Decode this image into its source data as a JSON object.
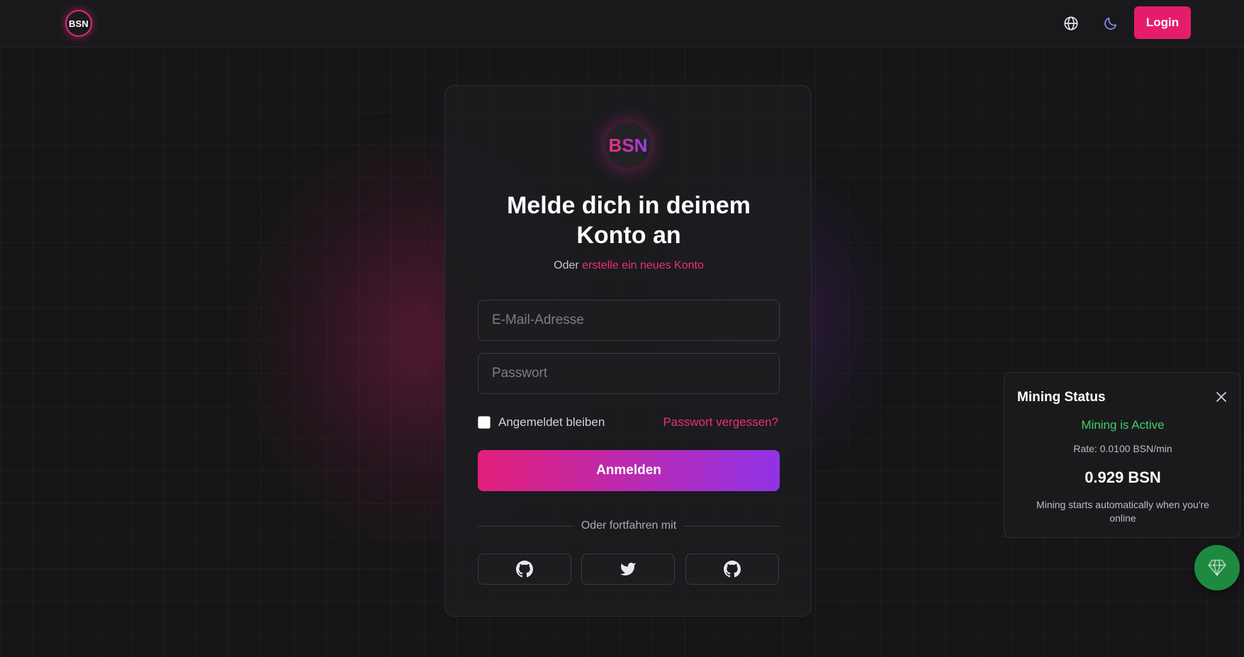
{
  "header": {
    "logo_text": "BSN",
    "login_label": "Login",
    "icons": [
      "globe-icon",
      "moon-icon"
    ]
  },
  "card": {
    "logo_text": "BSN",
    "title_line1": "Melde dich in deinem",
    "title_line2": "Konto an",
    "subtitle_prefix": "Oder",
    "subtitle_link": "erstelle ein neues Konto",
    "email_placeholder": "E-Mail-Adresse",
    "password_placeholder": "Passwort",
    "remember_label": "Angemeldet bleiben",
    "remember_checked": false,
    "forgot_label": "Passwort vergessen?",
    "submit_label": "Anmelden",
    "divider_label": "Oder fortfahren mit",
    "social_icons": [
      "github-icon",
      "twitter-icon",
      "github-icon"
    ]
  },
  "mining": {
    "title": "Mining Status",
    "status": "Mining is Active",
    "rate": "Rate: 0.0100 BSN/min",
    "amount": "0.929 BSN",
    "note": "Mining starts automatically when you're online"
  },
  "colors": {
    "accent": "#e61c6b",
    "gradient_start": "#e3207a",
    "gradient_end": "#9133e6",
    "active_green": "#3fd06a",
    "fab_green": "#1e8a3f",
    "background": "#161618"
  }
}
